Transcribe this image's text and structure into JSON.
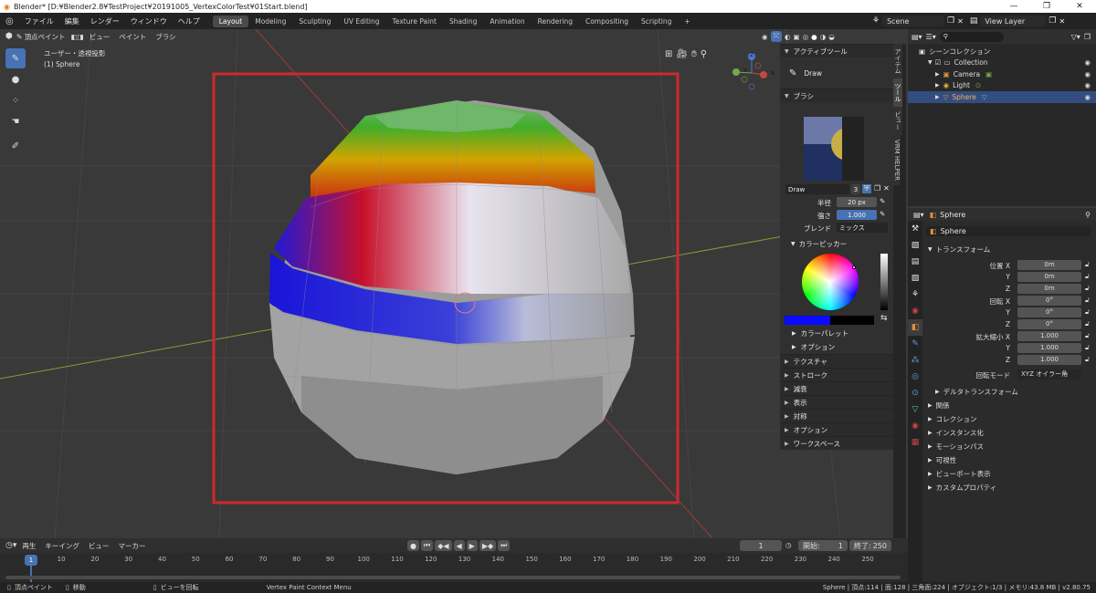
{
  "window": {
    "title": "Blender* [D:¥Blender2.8¥TestProject¥20191005_VertexColorTest¥01Start.blend]",
    "controls": [
      "—",
      "❐",
      "✕"
    ]
  },
  "menubar": {
    "items": [
      "ファイル",
      "編集",
      "レンダー",
      "ウィンドウ",
      "ヘルプ"
    ],
    "workspaces": [
      "Layout",
      "Modeling",
      "Sculpting",
      "UV Editing",
      "Texture Paint",
      "Shading",
      "Animation",
      "Rendering",
      "Compositing",
      "Scripting"
    ],
    "add_tab": "+",
    "scene": "Scene",
    "view_layer": "View Layer"
  },
  "viewport": {
    "mode": "頂点ペイント",
    "menus": [
      "ビュー",
      "ペイント",
      "ブラシ"
    ],
    "view_label": "ユーザー・透視投影",
    "object_label": "(1) Sphere",
    "gizmo_axes": [
      "Y",
      "X",
      "Z"
    ],
    "highlight_color": "#d0282e"
  },
  "npanel": {
    "active_tool_header": "アクティブツール",
    "active_tool": "Draw",
    "brush_header": "ブラシ",
    "brush_name": "Draw",
    "brush_users": "3",
    "radius_label": "半径",
    "radius_value": "20 px",
    "strength_label": "強さ",
    "strength_value": "1.000",
    "blend_label": "ブレンド",
    "blend_value": "ミックス",
    "color_picker_header": "カラーピッカー",
    "current_color": "#0a0aff",
    "secondary_color": "#000000",
    "sub_sections": [
      "カラーパレット",
      "オプション"
    ],
    "sections": [
      "テクスチャ",
      "ストローク",
      "減衰",
      "表示",
      "対称",
      "オプション",
      "ワークスペース"
    ]
  },
  "side_tabs": [
    "アイテム",
    "ツール",
    "ビュー",
    "VRM HELPER"
  ],
  "outliner": {
    "root": "シーンコレクション",
    "collection": "Collection",
    "items": [
      {
        "name": "Camera",
        "icon": "camera-icon",
        "color": "#e08f3b",
        "selected": false
      },
      {
        "name": "Light",
        "icon": "light-icon",
        "color": "#e0b33b",
        "selected": false
      },
      {
        "name": "Sphere",
        "icon": "mesh-icon",
        "color": "#e08f3b",
        "selected": true
      }
    ]
  },
  "properties": {
    "object_name": "Sphere",
    "object_field": "Sphere",
    "transform_header": "トランスフォーム",
    "location_label": "位置 X",
    "rotation_label": "回転 X",
    "scale_label": "拡大縮小 X",
    "axis_y": "Y",
    "axis_z": "Z",
    "location": [
      "0m",
      "0m",
      "0m"
    ],
    "rotation": [
      "0°",
      "0°",
      "0°"
    ],
    "scale": [
      "1.000",
      "1.000",
      "1.000"
    ],
    "rotation_mode_label": "回転モード",
    "rotation_mode": "XYZ オイラー角",
    "delta_transform": "デルタトランスフォーム",
    "sections": [
      "関係",
      "コレクション",
      "インスタンス化",
      "モーションパス",
      "可視性",
      "ビューポート表示",
      "カスタムプロパティ"
    ]
  },
  "timeline": {
    "menus": [
      "再生",
      "キーイング",
      "ビュー",
      "マーカー"
    ],
    "current_frame": "1",
    "start_label": "開始:",
    "start": "1",
    "end_label": "終了:",
    "end": "250",
    "ticks": [
      "1",
      "10",
      "20",
      "30",
      "40",
      "50",
      "60",
      "70",
      "80",
      "90",
      "100",
      "110",
      "120",
      "130",
      "140",
      "150",
      "160",
      "170",
      "180",
      "190",
      "200",
      "210",
      "220",
      "230",
      "240",
      "250"
    ]
  },
  "statusbar": {
    "left": [
      "頂点ペイント",
      "移動",
      "ビューを回転",
      "Vertex Paint Context Menu"
    ],
    "right": "Sphere | 頂点:114 | 面:128 | 三角面:224 | オブジェクト:1/3 | メモリ:43.8 MB | v2.80.75"
  }
}
